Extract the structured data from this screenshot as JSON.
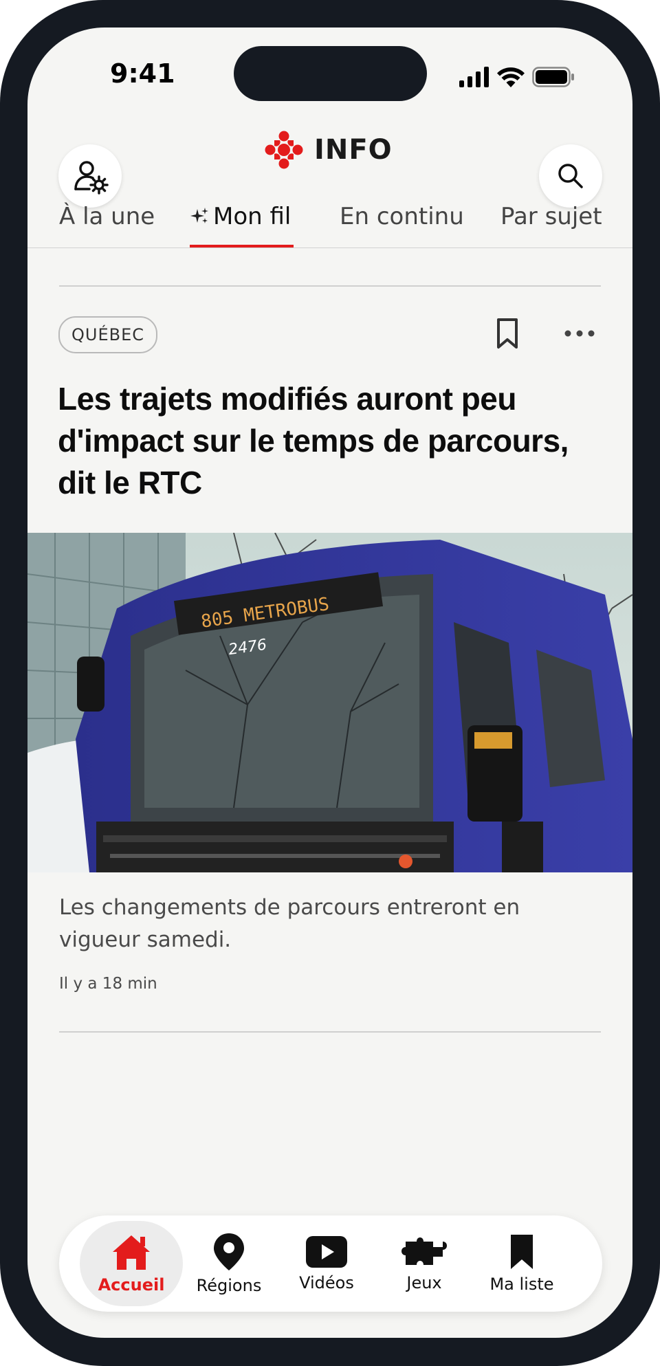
{
  "status_bar": {
    "time": "9:41"
  },
  "header": {
    "brand": "INFO",
    "brand_color": "#e31c1c"
  },
  "tabs": [
    {
      "label": "À la une",
      "active": false
    },
    {
      "label": "Mon fil",
      "active": true
    },
    {
      "label": "En continu",
      "active": false
    },
    {
      "label": "Par sujet",
      "active": false
    }
  ],
  "article": {
    "tag": "QUÉBEC",
    "headline": "Les trajets modifiés auront peu d'impact sur le temps de parcours, dit le RTC",
    "image_sign": "805  METROBUS",
    "bus_number": "2476",
    "summary": "Les changements de parcours entreront en vigueur samedi.",
    "timestamp": "Il y a 18 min"
  },
  "bottom_nav": [
    {
      "label": "Accueil",
      "icon": "home-icon",
      "active": true
    },
    {
      "label": "Régions",
      "icon": "location-pin-icon",
      "active": false
    },
    {
      "label": "Vidéos",
      "icon": "play-icon",
      "active": false
    },
    {
      "label": "Jeux",
      "icon": "puzzle-icon",
      "active": false
    },
    {
      "label": "Ma liste",
      "icon": "bookmark-icon",
      "active": false
    }
  ],
  "colors": {
    "accent": "#e31c1c",
    "background": "#f5f5f3",
    "frame": "#151a22"
  }
}
